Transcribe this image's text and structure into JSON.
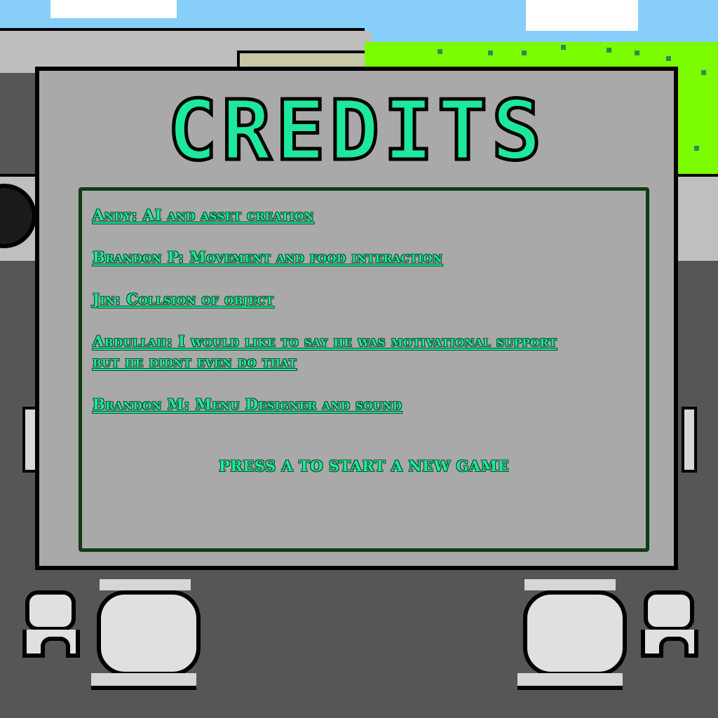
{
  "screen": {
    "title": "CREDITS",
    "credits": [
      "Andy: AI and asset creation",
      "Brandon P: Movement and food interaction",
      "Jin: Collsion of object",
      "Abdullah: I would like to say he was motivational support but he didnt even do that",
      "Brandon M: Menu Designer and sound"
    ],
    "prompt": "PRESS A TO START A NEW GAME"
  },
  "colors": {
    "accent": "#1ee89c",
    "board": "#a9a9a9",
    "panel_border": "#0c3d14",
    "floor": "#565656",
    "grass": "#7cfc00",
    "sky": "#87cefa"
  }
}
